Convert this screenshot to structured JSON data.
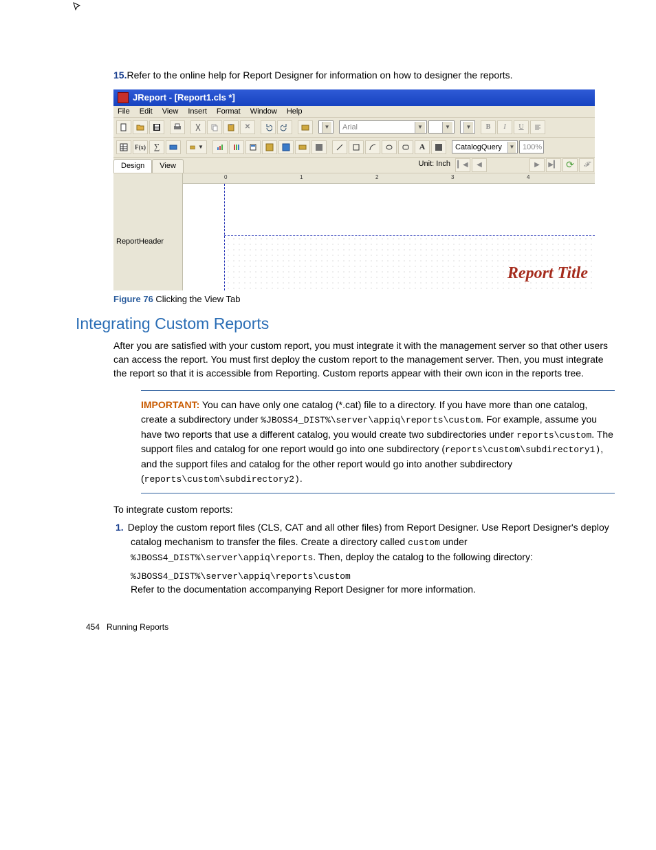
{
  "step15": {
    "num": "15.",
    "text": "Refer to the online help for Report Designer for information on how to designer the reports."
  },
  "screenshot": {
    "title": "JReport - [Report1.cls *]",
    "menus": [
      "File",
      "Edit",
      "View",
      "Insert",
      "Format",
      "Window",
      "Help"
    ],
    "font_dropdown": "Arial",
    "catalog_dropdown": "CatalogQuery",
    "zoom": "100%",
    "tabs": {
      "design": "Design",
      "view": "View"
    },
    "unit_label": "Unit: Inch",
    "ruler_nums": [
      "0",
      "1",
      "2",
      "3",
      "4"
    ],
    "left_label": "ReportHeader",
    "report_title": "Report Title"
  },
  "figure": {
    "label": "Figure 76",
    "caption": " Clicking the View Tab"
  },
  "section_heading": "Integrating Custom Reports",
  "intro_para": "After you are satisfied with your custom report, you must integrate it with the management server so that other users can access the report. You must first deploy the custom report to the management server. Then, you must integrate the report so that it is accessible from Reporting. Custom reports appear with their own icon in the reports tree.",
  "important": {
    "label": "IMPORTANT:",
    "t1": "   You can have only one catalog (*.cat) file to a directory. If you have more than one catalog, create a subdirectory under ",
    "m1": "%JBOSS4_DIST%\\server\\appiq\\reports\\custom",
    "t2": ". For example, assume you have two reports that use a different catalog, you would create two subdirectories under ",
    "m2": "reports\\custom",
    "t3": ". The support files and catalog for one report would go into one subdirectory (",
    "m3": "reports\\custom\\subdirectory1)",
    "t4": ", and the support files and catalog for the other report would go into another subdirectory (",
    "m4": "reports\\custom\\subdirectory2)",
    "t5": "."
  },
  "integrate_intro": "To integrate custom reports:",
  "step1": {
    "num": "1.",
    "t1": "Deploy the custom report files (CLS, CAT and all other files) from Report Designer. Use Report Designer's deploy catalog mechanism to transfer the files. Create a directory called ",
    "m1": "custom",
    "t2": " under ",
    "m2": "%JBOSS4_DIST%\\server\\appiq\\reports",
    "t3": ". Then, deploy the catalog to the following directory:"
  },
  "mono_path": "%JBOSS4_DIST%\\server\\appiq\\reports\\custom",
  "step1_follow": "Refer to the documentation accompanying Report Designer for more information.",
  "footer": {
    "page": "454",
    "title": "Running Reports"
  }
}
